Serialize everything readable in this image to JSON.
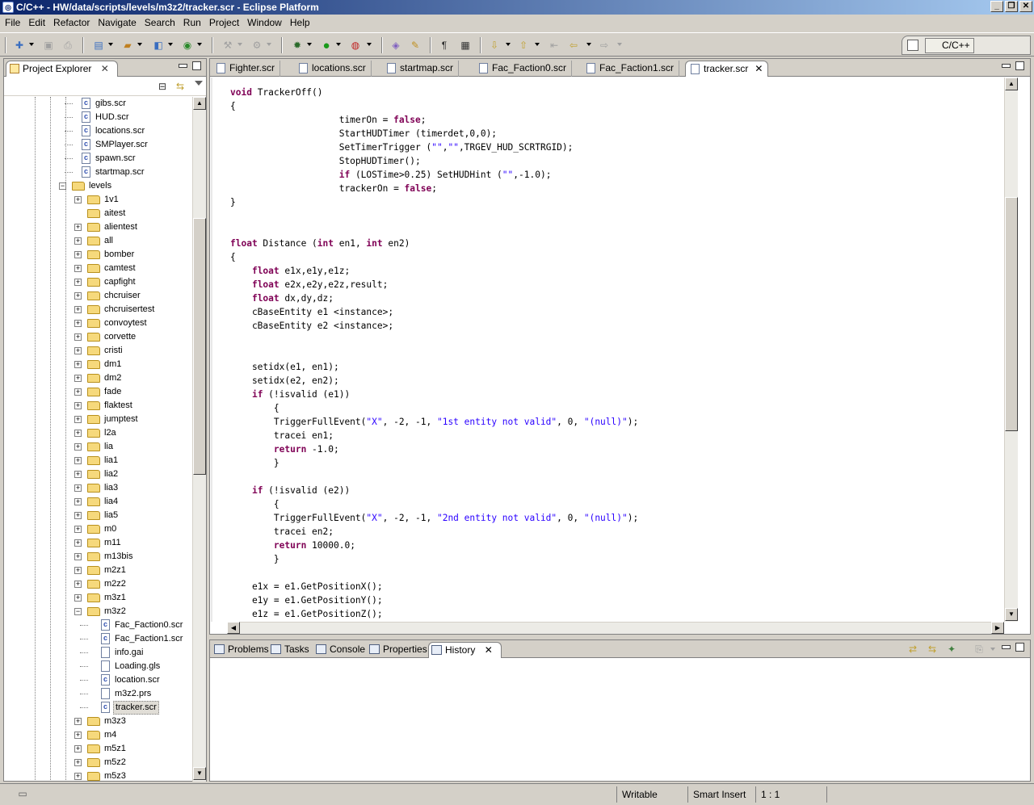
{
  "window": {
    "title": "C/C++ - HW/data/scripts/levels/m3z2/tracker.scr - Eclipse Platform"
  },
  "menu": [
    "File",
    "Edit",
    "Refactor",
    "Navigate",
    "Search",
    "Run",
    "Project",
    "Window",
    "Help"
  ],
  "perspective": {
    "label": "C/C++"
  },
  "project_explorer": {
    "title": "Project Explorer",
    "items": [
      {
        "label": "gibs.scr",
        "type": "file-c",
        "depth": 2
      },
      {
        "label": "HUD.scr",
        "type": "file-c",
        "depth": 2
      },
      {
        "label": "locations.scr",
        "type": "file-c",
        "depth": 2
      },
      {
        "label": "SMPlayer.scr",
        "type": "file-c",
        "depth": 2
      },
      {
        "label": "spawn.scr",
        "type": "file-c",
        "depth": 2
      },
      {
        "label": "startmap.scr",
        "type": "file-c",
        "depth": 2
      },
      {
        "label": "levels",
        "type": "folder-open",
        "depth": 1
      },
      {
        "label": "1v1",
        "type": "folder",
        "depth": 2
      },
      {
        "label": "aitest",
        "type": "folder-noexp",
        "depth": 2
      },
      {
        "label": "alientest",
        "type": "folder",
        "depth": 2
      },
      {
        "label": "all",
        "type": "folder",
        "depth": 2
      },
      {
        "label": "bomber",
        "type": "folder",
        "depth": 2
      },
      {
        "label": "camtest",
        "type": "folder",
        "depth": 2
      },
      {
        "label": "capfight",
        "type": "folder",
        "depth": 2
      },
      {
        "label": "chcruiser",
        "type": "folder",
        "depth": 2
      },
      {
        "label": "chcruisertest",
        "type": "folder",
        "depth": 2
      },
      {
        "label": "convoytest",
        "type": "folder",
        "depth": 2
      },
      {
        "label": "corvette",
        "type": "folder",
        "depth": 2
      },
      {
        "label": "cristi",
        "type": "folder",
        "depth": 2
      },
      {
        "label": "dm1",
        "type": "folder",
        "depth": 2
      },
      {
        "label": "dm2",
        "type": "folder",
        "depth": 2
      },
      {
        "label": "fade",
        "type": "folder",
        "depth": 2
      },
      {
        "label": "flaktest",
        "type": "folder",
        "depth": 2
      },
      {
        "label": "jumptest",
        "type": "folder",
        "depth": 2
      },
      {
        "label": "l2a",
        "type": "folder",
        "depth": 2
      },
      {
        "label": "lia",
        "type": "folder",
        "depth": 2
      },
      {
        "label": "lia1",
        "type": "folder",
        "depth": 2
      },
      {
        "label": "lia2",
        "type": "folder",
        "depth": 2
      },
      {
        "label": "lia3",
        "type": "folder",
        "depth": 2
      },
      {
        "label": "lia4",
        "type": "folder",
        "depth": 2
      },
      {
        "label": "lia5",
        "type": "folder",
        "depth": 2
      },
      {
        "label": "m0",
        "type": "folder",
        "depth": 2
      },
      {
        "label": "m11",
        "type": "folder",
        "depth": 2
      },
      {
        "label": "m13bis",
        "type": "folder",
        "depth": 2
      },
      {
        "label": "m2z1",
        "type": "folder",
        "depth": 2
      },
      {
        "label": "m2z2",
        "type": "folder",
        "depth": 2
      },
      {
        "label": "m3z1",
        "type": "folder",
        "depth": 2
      },
      {
        "label": "m3z2",
        "type": "folder-open",
        "depth": 2
      },
      {
        "label": "Fac_Faction0.scr",
        "type": "file-c",
        "depth": 3
      },
      {
        "label": "Fac_Faction1.scr",
        "type": "file-c",
        "depth": 3
      },
      {
        "label": "info.gai",
        "type": "file",
        "depth": 3
      },
      {
        "label": "Loading.gls",
        "type": "file",
        "depth": 3
      },
      {
        "label": "location.scr",
        "type": "file-c",
        "depth": 3
      },
      {
        "label": "m3z2.prs",
        "type": "file",
        "depth": 3
      },
      {
        "label": "tracker.scr",
        "type": "file-c",
        "depth": 3,
        "selected": true
      },
      {
        "label": "m3z3",
        "type": "folder",
        "depth": 2
      },
      {
        "label": "m4",
        "type": "folder",
        "depth": 2
      },
      {
        "label": "m5z1",
        "type": "folder",
        "depth": 2
      },
      {
        "label": "m5z2",
        "type": "folder",
        "depth": 2
      },
      {
        "label": "m5z3",
        "type": "folder",
        "depth": 2
      }
    ]
  },
  "editor": {
    "tabs": [
      "Fighter.scr",
      "locations.scr",
      "startmap.scr",
      "Fac_Faction0.scr",
      "Fac_Faction1.scr",
      "tracker.scr"
    ],
    "active_tab": "tracker.scr",
    "lines": [
      [
        [
          "kw",
          "void"
        ],
        [
          "p",
          " TrackerOff()"
        ]
      ],
      [
        [
          "p",
          "{"
        ]
      ],
      [
        [
          "p",
          "                    timerOn = "
        ],
        [
          "kw",
          "false"
        ],
        [
          "p",
          ";"
        ]
      ],
      [
        [
          "p",
          "                    StartHUDTimer (timerdet,0,0);"
        ]
      ],
      [
        [
          "p",
          "                    SetTimerTrigger ("
        ],
        [
          "str",
          "\"\""
        ],
        [
          "p",
          ","
        ],
        [
          "str",
          "\"\""
        ],
        [
          "p",
          ",TRGEV_HUD_SCRTRGID);"
        ]
      ],
      [
        [
          "p",
          "                    StopHUDTimer();"
        ]
      ],
      [
        [
          "p",
          "                    "
        ],
        [
          "kw",
          "if"
        ],
        [
          "p",
          " (LOSTime>0.25) SetHUDHint ("
        ],
        [
          "str",
          "\"\""
        ],
        [
          "p",
          ",-1.0);"
        ]
      ],
      [
        [
          "p",
          "                    trackerOn = "
        ],
        [
          "kw",
          "false"
        ],
        [
          "p",
          ";"
        ]
      ],
      [
        [
          "p",
          "}"
        ]
      ],
      [
        [
          "p",
          ""
        ]
      ],
      [
        [
          "p",
          ""
        ]
      ],
      [
        [
          "kw",
          "float"
        ],
        [
          "p",
          " Distance ("
        ],
        [
          "kw",
          "int"
        ],
        [
          "p",
          " en1, "
        ],
        [
          "kw",
          "int"
        ],
        [
          "p",
          " en2)"
        ]
      ],
      [
        [
          "p",
          "{"
        ]
      ],
      [
        [
          "p",
          "    "
        ],
        [
          "kw",
          "float"
        ],
        [
          "p",
          " e1x,e1y,e1z;"
        ]
      ],
      [
        [
          "p",
          "    "
        ],
        [
          "kw",
          "float"
        ],
        [
          "p",
          " e2x,e2y,e2z,result;"
        ]
      ],
      [
        [
          "p",
          "    "
        ],
        [
          "kw",
          "float"
        ],
        [
          "p",
          " dx,dy,dz;"
        ]
      ],
      [
        [
          "p",
          "    cBaseEntity e1 <instance>;"
        ]
      ],
      [
        [
          "p",
          "    cBaseEntity e2 <instance>;"
        ]
      ],
      [
        [
          "p",
          ""
        ]
      ],
      [
        [
          "p",
          ""
        ]
      ],
      [
        [
          "p",
          "    setidx(e1, en1);"
        ]
      ],
      [
        [
          "p",
          "    setidx(e2, en2);"
        ]
      ],
      [
        [
          "p",
          "    "
        ],
        [
          "kw",
          "if"
        ],
        [
          "p",
          " (!isvalid (e1))"
        ]
      ],
      [
        [
          "p",
          "        {"
        ]
      ],
      [
        [
          "p",
          "        TriggerFullEvent("
        ],
        [
          "str",
          "\"X\""
        ],
        [
          "p",
          ", -2, -1, "
        ],
        [
          "str",
          "\"1st entity not valid\""
        ],
        [
          "p",
          ", 0, "
        ],
        [
          "str",
          "\"(null)\""
        ],
        [
          "p",
          ");"
        ]
      ],
      [
        [
          "p",
          "        tracei en1;"
        ]
      ],
      [
        [
          "p",
          "        "
        ],
        [
          "kw",
          "return"
        ],
        [
          "p",
          " -1.0;"
        ]
      ],
      [
        [
          "p",
          "        }"
        ]
      ],
      [
        [
          "p",
          ""
        ]
      ],
      [
        [
          "p",
          "    "
        ],
        [
          "kw",
          "if"
        ],
        [
          "p",
          " (!isvalid (e2))"
        ]
      ],
      [
        [
          "p",
          "        {"
        ]
      ],
      [
        [
          "p",
          "        TriggerFullEvent("
        ],
        [
          "str",
          "\"X\""
        ],
        [
          "p",
          ", -2, -1, "
        ],
        [
          "str",
          "\"2nd entity not valid\""
        ],
        [
          "p",
          ", 0, "
        ],
        [
          "str",
          "\"(null)\""
        ],
        [
          "p",
          ");"
        ]
      ],
      [
        [
          "p",
          "        tracei en2;"
        ]
      ],
      [
        [
          "p",
          "        "
        ],
        [
          "kw",
          "return"
        ],
        [
          "p",
          " 10000.0;"
        ]
      ],
      [
        [
          "p",
          "        }"
        ]
      ],
      [
        [
          "p",
          ""
        ]
      ],
      [
        [
          "p",
          "    e1x = e1.GetPositionX();"
        ]
      ],
      [
        [
          "p",
          "    e1y = e1.GetPositionY();"
        ]
      ],
      [
        [
          "p",
          "    e1z = e1.GetPositionZ();"
        ]
      ]
    ]
  },
  "bottom_panel": {
    "tabs": [
      "Problems",
      "Tasks",
      "Console",
      "Properties",
      "History"
    ],
    "active_tab": "History"
  },
  "status": {
    "writable": "Writable",
    "insert_mode": "Smart Insert",
    "position": "1 : 1"
  }
}
